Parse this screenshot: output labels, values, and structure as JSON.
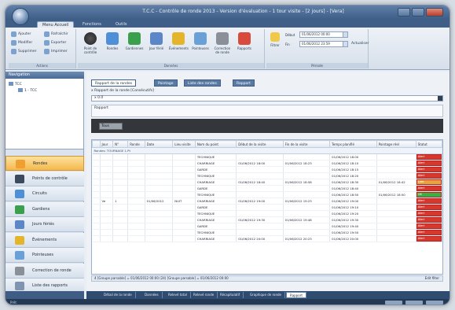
{
  "window": {
    "title": "T.C.C - Contrôle de ronde 2013 - Version d'évaluation - 1 tour visite - [2 jours] - [Vera]"
  },
  "ribbon": {
    "tabs": [
      "Menu Accueil",
      "Fonctions",
      "Outils"
    ],
    "active_tab": 0,
    "group1": {
      "items": [
        "Ajouter",
        "Modifier",
        "Supprimer",
        "Rafraîchir",
        "Exporter",
        "Imprimer"
      ],
      "caption": "Actions"
    },
    "group2": {
      "buttons": [
        "Point de contrôle",
        "Rondes",
        "Gardiennes",
        "Jour férié",
        "Événements",
        "Pointeuses",
        "Correction de ronde",
        "Rapports"
      ],
      "caption": "Données"
    },
    "group3": {
      "date_label": "Début",
      "date_value": "01/06/2012 00:00",
      "label2": "Fin",
      "value2": "01/06/2012 23:59",
      "button": "Filtrer",
      "button2": "Actualiser",
      "caption": "Période"
    }
  },
  "left": {
    "header": "Navigation",
    "tree": [
      {
        "label": "TCC",
        "level": 0
      },
      {
        "label": "1 - TCC",
        "level": 1
      }
    ],
    "nav": [
      {
        "label": "Rondes",
        "icon": "rounds-icon",
        "color": "#f0a030",
        "selected": true
      },
      {
        "label": "Points de contrôle",
        "icon": "checkpoint-icon",
        "color": "#3b4a5c"
      },
      {
        "label": "Circuits",
        "icon": "circuit-icon",
        "color": "#4e8fd8"
      },
      {
        "label": "Gardiens",
        "icon": "guard-icon",
        "color": "#3aa04c"
      },
      {
        "label": "Jours fériés",
        "icon": "calendar-icon",
        "color": "#5b87c8"
      },
      {
        "label": "Événements",
        "icon": "events-icon",
        "color": "#e4b52a"
      },
      {
        "label": "Pointeuses",
        "icon": "reader-icon",
        "color": "#6aa0d8"
      },
      {
        "label": "Correction de ronde",
        "icon": "correction-icon",
        "color": "#8a8f98"
      },
      {
        "label": "Liste des rapports",
        "icon": "report-icon",
        "color": "#7f94b0"
      }
    ]
  },
  "main": {
    "doc_tabs": [
      {
        "label": "Rapport de la rondes",
        "active": true
      },
      {
        "label": "Pointage",
        "active": false
      },
      {
        "label": "Liste des rondes",
        "active": false
      },
      {
        "label": "Rapport",
        "active": false
      }
    ],
    "filter_label": "x   Rapport de la ronde [Consécutifs]",
    "filter_value": "x 0.0",
    "group_panel": "Rapport",
    "combo_value": "Tous",
    "columns": [
      "",
      "Jour",
      "N°",
      "Ronde",
      "Date",
      "Lieu visite",
      "Nom du point",
      "Début de la visite",
      "Fin de la visite",
      "Temps planifié",
      "Pointage réel",
      "Statut"
    ],
    "group_row": "Rondes: TOURNAGE 1.Pt",
    "rows": [
      {
        "point": "TECHNIQUE",
        "start": "",
        "end": "",
        "planned": "01/06/2012 18:00",
        "real": "",
        "status": "Alert",
        "color": "#d7382d"
      },
      {
        "point": "CHARRIAGE",
        "start": "01/06/2012 18:00",
        "end": "01/06/2012 18:23",
        "planned": "01/06/2012 18:10",
        "real": "",
        "status": "Alert",
        "color": "#d7382d"
      },
      {
        "point": "GARDE",
        "start": "",
        "end": "",
        "planned": "01/06/2012 18:15",
        "real": "",
        "status": "Alert",
        "color": "#d7382d"
      },
      {
        "point": "TECHNIQUE",
        "start": "",
        "end": "",
        "planned": "01/06/2012 18:20",
        "real": "",
        "status": "Alert",
        "color": "#d7382d"
      },
      {
        "point": "CHARRIAGE",
        "start": "01/06/2012 18:40",
        "end": "01/06/2012 18:58",
        "planned": "01/06/2012 18:30",
        "real": "01/06/2012 18:42",
        "status": "Late",
        "color": "#e8a33c"
      },
      {
        "point": "GARDE",
        "start": "",
        "end": "",
        "planned": "01/06/2012 18:40",
        "real": "",
        "status": "Alert",
        "color": "#d7382d"
      },
      {
        "point": "TECHNIQUE",
        "start": "",
        "end": "",
        "planned": "01/06/2012 18:50",
        "real": "01/06/2012 18:50",
        "status": "OK",
        "color": "#3bb042"
      },
      {
        "point": "CHARRIAGE",
        "start": "01/06/2012 19:00",
        "end": "01/06/2012 19:23",
        "planned": "01/06/2012 19:00",
        "real": "",
        "status": "Alert",
        "color": "#d7382d"
      },
      {
        "point": "GARDE",
        "start": "",
        "end": "",
        "planned": "01/06/2012 19:10",
        "real": "",
        "status": "Alert",
        "color": "#d7382d"
      },
      {
        "point": "TECHNIQUE",
        "start": "",
        "end": "",
        "planned": "01/06/2012 19:20",
        "real": "",
        "status": "Alert",
        "color": "#d7382d"
      },
      {
        "point": "CHARRIAGE",
        "start": "01/06/2012 19:30",
        "end": "01/06/2012 19:48",
        "planned": "01/06/2012 19:30",
        "real": "",
        "status": "Alert",
        "color": "#d7382d"
      },
      {
        "point": "GARDE",
        "start": "",
        "end": "",
        "planned": "01/06/2012 19:40",
        "real": "",
        "status": "Alert",
        "color": "#d7382d"
      },
      {
        "point": "TECHNIQUE",
        "start": "",
        "end": "",
        "planned": "01/06/2012 19:50",
        "real": "",
        "status": "Alert",
        "color": "#d7382d"
      },
      {
        "point": "CHARRIAGE",
        "start": "01/06/2012 20:00",
        "end": "01/06/2012 20:23",
        "planned": "01/06/2012 20:00",
        "real": "",
        "status": "Alert",
        "color": "#d7382d"
      }
    ],
    "row_meta": {
      "day": "Ve",
      "num": "1",
      "round": "01/06/2012",
      "place": "NUIT"
    },
    "footer_left": "4   [Groupe parsable] = 01/06/2012 00:00 (24)  [Groupe parsable] = 01/06/2012 00:00",
    "footer_right": "Edit filter"
  },
  "bottom_tabs": [
    {
      "label": "Détail de la ronde",
      "active": false
    },
    {
      "label": "Données",
      "active": false
    },
    {
      "label": "Relevé total",
      "active": false
    },
    {
      "label": "Relevé ronde",
      "active": false
    },
    {
      "label": "Récapitulatif",
      "active": false
    },
    {
      "label": "Graphique de ronde",
      "active": false
    },
    {
      "label": "Rapport",
      "active": true
    }
  ],
  "status": {
    "text": "Prêt"
  }
}
